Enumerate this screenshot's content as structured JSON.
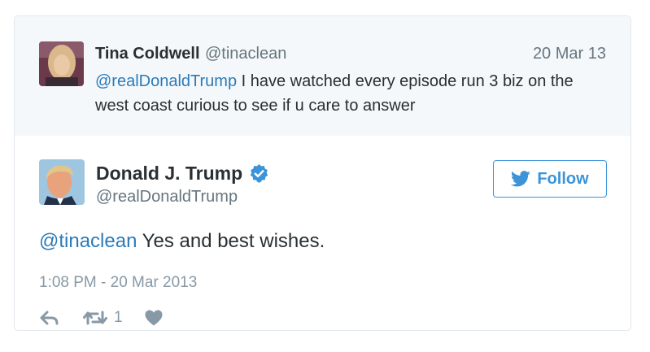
{
  "parent_tweet": {
    "author_name": "Tina Coldwell",
    "author_handle": "@tinaclean",
    "date": "20 Mar 13",
    "text_mention": "@realDonaldTrump",
    "text_body": " I have watched every episode run 3 biz on the west coast curious to see if u care to answer",
    "avatar_icon": "user-photo-avatar"
  },
  "main_tweet": {
    "author_name": "Donald J. Trump",
    "author_handle": "@realDonaldTrump",
    "verified_icon": "verified-badge-icon",
    "follow_label": "Follow",
    "text_mention": "@tinaclean",
    "text_body": " Yes and best wishes.",
    "timestamp": "1:08 PM - 20 Mar 2013",
    "actions": {
      "reply_icon": "reply-icon",
      "retweet_icon": "retweet-icon",
      "retweet_count": "1",
      "like_icon": "heart-icon"
    }
  },
  "colors": {
    "link": "#2b7bb9",
    "follow_accent": "#3b94d9",
    "muted": "#66757f",
    "parent_bg": "#f5f8fa",
    "border": "#e1e8ed"
  }
}
